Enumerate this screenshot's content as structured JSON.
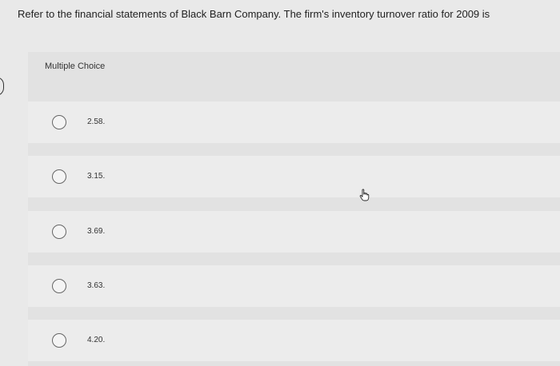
{
  "question": {
    "text": "Refer to the financial statements of Black Barn Company. The firm's inventory turnover ratio for 2009 is"
  },
  "answer": {
    "section_label": "Multiple Choice",
    "options": [
      {
        "label": "2.58."
      },
      {
        "label": "3.15."
      },
      {
        "label": "3.69."
      },
      {
        "label": "3.63."
      },
      {
        "label": "4.20."
      }
    ]
  },
  "icons": {
    "radio": "radio-unselected-icon",
    "cursor": "hand-pointer-icon"
  }
}
